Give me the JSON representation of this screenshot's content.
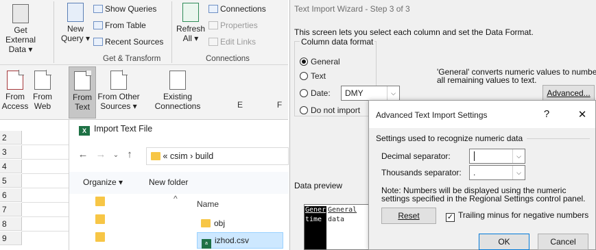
{
  "ribbon": {
    "get_external_data": [
      "Get External",
      "Data ▾"
    ],
    "new_query": [
      "New",
      "Query ▾"
    ],
    "show_queries": "Show Queries",
    "from_table": "From Table",
    "recent_sources": "Recent Sources",
    "group_get_transform": "Get & Transform",
    "refresh_all": [
      "Refresh",
      "All ▾"
    ],
    "connections": "Connections",
    "properties": "Properties",
    "edit_links": "Edit Links",
    "group_connections": "Connections"
  },
  "external_data": {
    "items": [
      {
        "label": [
          "From",
          "Access"
        ]
      },
      {
        "label": [
          "From",
          "Web"
        ]
      },
      {
        "label": [
          "From",
          "Text"
        ]
      },
      {
        "label": [
          "From Other",
          "Sources ▾"
        ]
      },
      {
        "label": [
          "Existing",
          "Connections"
        ]
      }
    ]
  },
  "sheet": {
    "columns": [
      "E",
      "F"
    ],
    "rows": [
      "2",
      "3",
      "4",
      "5",
      "6",
      "7",
      "8",
      "9"
    ]
  },
  "import_dialog": {
    "title": "Import Text File",
    "breadcrumb": [
      "«",
      "csim",
      "›",
      "build"
    ],
    "organize": "Organize ▾",
    "new_folder": "New folder",
    "name_header": "Name",
    "files": [
      "obj",
      "izhod.csv"
    ]
  },
  "wizard": {
    "title": "Text Import Wizard - Step 3 of 3",
    "intro": "This screen lets you select each column and set the Data Format.",
    "column_data_format": "Column data format",
    "options": [
      "General",
      "Text",
      "Date:",
      "Do not import"
    ],
    "date_value": "DMY",
    "general_info": [
      "'General' converts numeric values to numbe",
      "all remaining values to text."
    ],
    "advanced": "Advanced...",
    "data_preview": "Data preview",
    "preview_headers": [
      "Gener",
      "General"
    ],
    "preview_row": [
      "time",
      "data"
    ]
  },
  "advanced_dialog": {
    "title": "Advanced Text Import Settings",
    "help": "?",
    "close": "✕",
    "section": "Settings used to recognize numeric data",
    "decimal_label": "Decimal separator:",
    "decimal_value": "",
    "thousands_label": "Thousands separator:",
    "thousands_value": ".",
    "note": [
      "Note: Numbers will be displayed using the numeric",
      "settings specified in the Regional Settings control panel."
    ],
    "reset": "Reset",
    "trailing_minus": "Trailing minus for negative numbers",
    "trailing_checked": "✓",
    "ok": "OK",
    "cancel": "Cancel"
  }
}
